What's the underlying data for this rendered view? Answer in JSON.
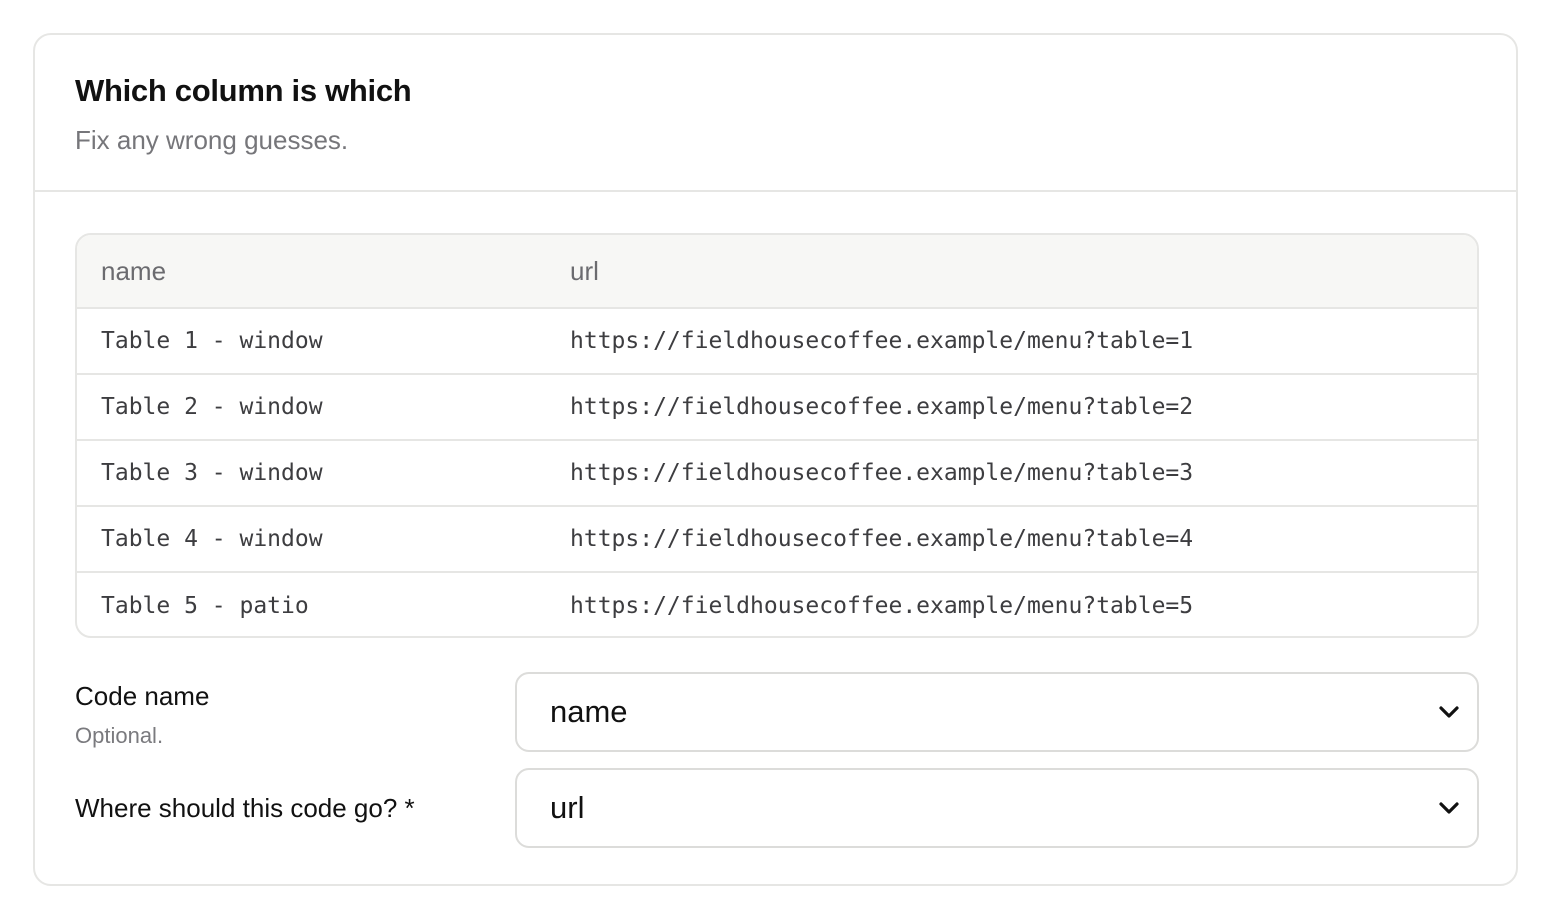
{
  "header": {
    "title": "Which column is which",
    "subtitle": "Fix any wrong guesses."
  },
  "table": {
    "columns": [
      "name",
      "url"
    ],
    "rows": [
      [
        "Table 1 - window",
        "https://fieldhousecoffee.example/menu?table=1"
      ],
      [
        "Table 2 - window",
        "https://fieldhousecoffee.example/menu?table=2"
      ],
      [
        "Table 3 - window",
        "https://fieldhousecoffee.example/menu?table=3"
      ],
      [
        "Table 4 - window",
        "https://fieldhousecoffee.example/menu?table=4"
      ],
      [
        "Table 5 - patio",
        "https://fieldhousecoffee.example/menu?table=5"
      ]
    ]
  },
  "fields": {
    "code_name": {
      "label": "Code name",
      "hint": "Optional.",
      "selected": "name"
    },
    "destination": {
      "label": "Where should this code go? *",
      "selected": "url"
    }
  },
  "icons": {
    "select_arrow": "chevron-down-icon"
  }
}
